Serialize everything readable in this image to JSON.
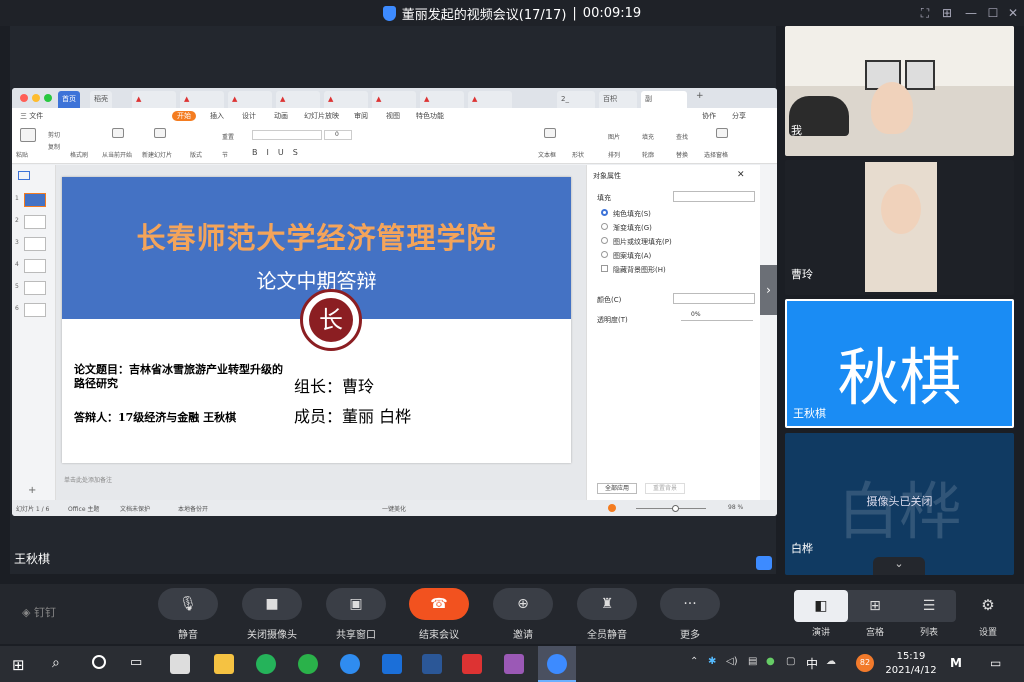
{
  "meeting": {
    "title": "董丽发起的视频会议(17/17)",
    "separator": "|",
    "timer": "00:09:19"
  },
  "ppt": {
    "tabs": [
      "首页",
      "稻壳",
      "2_",
      "百枳",
      "副"
    ],
    "menu": [
      "三 文件",
      "开始",
      "插入",
      "设计",
      "动画",
      "幻灯片放映",
      "审阅",
      "视图",
      "特色功能"
    ],
    "menu_right": [
      "协作",
      "分享"
    ],
    "toolbar": {
      "paste": "粘贴",
      "cut": "剪切",
      "copy": "复制",
      "format_painter": "格式刷",
      "from_current": "从当前开始",
      "new_slide": "新建幻灯片",
      "layout": "版式",
      "section": "节",
      "reset": "重置",
      "font_size": "0",
      "textbox": "文本框",
      "shape": "形状",
      "picture": "图片",
      "arrange": "排列",
      "fill": "填充",
      "outline": "轮廓",
      "find": "查找",
      "replace": "替换",
      "select_pane": "选择窗格"
    },
    "slide": {
      "title": "长春师范大学经济管理学院",
      "subtitle": "论文中期答辩",
      "logo_char": "长",
      "topic_label": "论文题目：吉林省冰雪旅游产业转型升级的路径研究",
      "defender": "答辩人：17级经济与金融 王秋棋",
      "leader": "组长：曹玲",
      "members": "成员：董丽   白桦"
    },
    "thumb_numbers": [
      "1",
      "2",
      "3",
      "4",
      "5",
      "6"
    ],
    "add_slide": "+",
    "notes_placeholder": "单击此处添加备注",
    "props": {
      "title": "对象属性",
      "fill": "填充",
      "options": [
        "纯色填充(S)",
        "渐变填充(G)",
        "图片或纹理填充(P)",
        "图案填充(A)",
        "隐藏背景图形(H)"
      ],
      "color": "颜色(C)",
      "transparency": "透明度(T)",
      "transparency_value": "0%",
      "apply_all": "全部应用",
      "reset_bg": "重置背景"
    },
    "status": {
      "slide": "幻灯片 1 / 6",
      "theme": "Office 主题",
      "doc_protect": "文档未保护",
      "backup": "本地备份开",
      "beautify": "一键美化",
      "zoom": "98 %",
      "zoom_fraction": 0.55
    }
  },
  "presenter_name": "王秋棋",
  "participants": [
    {
      "name": "我"
    },
    {
      "name": "曹玲"
    },
    {
      "name": "王秋棋",
      "avatar_text": "秋棋"
    },
    {
      "name": "白桦",
      "avatar_text": "白桦",
      "camera_status": "摄像头已关闭"
    }
  ],
  "controls": [
    "静音",
    "关闭摄像头",
    "共享窗口",
    "结束会议",
    "邀请",
    "全员静音",
    "更多"
  ],
  "view_modes": [
    "演讲",
    "宫格",
    "列表"
  ],
  "settings_label": "设置",
  "brand": "钉钉",
  "taskbar": {
    "time": "15:19",
    "date": "2021/4/12",
    "ime": "中",
    "badge": "82"
  },
  "colors": {
    "end_call": "#f2521f",
    "accent_blue": "#1a8cf4",
    "slide_header": "#4472c4",
    "slide_title": "#f4a45a"
  }
}
